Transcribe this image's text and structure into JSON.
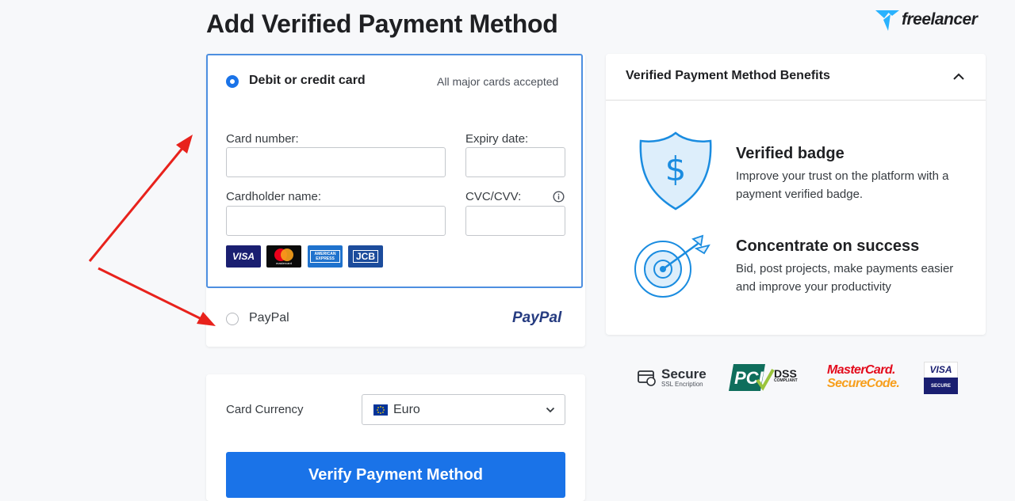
{
  "page_title": "Add Verified Payment Method",
  "logo_text": "freelancer",
  "payment": {
    "card_option_label": "Debit or credit card",
    "card_option_note": "All major cards accepted",
    "card_number_label": "Card number:",
    "expiry_label": "Expiry date:",
    "cardholder_label": "Cardholder name:",
    "cvc_label": "CVC/CVV:",
    "card_number_value": "",
    "expiry_value": "",
    "cardholder_value": "",
    "cvc_value": "",
    "card_brands": [
      "VISA",
      "mastercard",
      "AMERICAN EXPRESS",
      "JCB"
    ],
    "paypal_label": "PayPal",
    "paypal_logo": "PayPal"
  },
  "currency": {
    "label": "Card Currency",
    "selected": "Euro"
  },
  "verify_button": "Verify Payment Method",
  "benefits": {
    "header": "Verified Payment Method Benefits",
    "items": [
      {
        "title": "Verified badge",
        "desc": "Improve your trust on the platform with a payment verified badge.",
        "icon": "shield-dollar-icon"
      },
      {
        "title": "Concentrate on success",
        "desc": "Bid, post projects, make payments easier and improve your productivity",
        "icon": "target-icon"
      }
    ]
  },
  "trust_badges": {
    "secure": "Secure",
    "secure_sub": "SSL Encription",
    "pci_main": "PCI",
    "pci_dss": "DSS",
    "pci_sub": "COMPLIANT",
    "mc_top": "MasterCard.",
    "mc_bottom": "SecureCode.",
    "visa_top": "VISA",
    "visa_bottom": "SECURE"
  },
  "colors": {
    "accent": "#1a73e8",
    "arrow": "#e8221c",
    "paypal_dark": "#253b80",
    "paypal_light": "#179bd7"
  }
}
